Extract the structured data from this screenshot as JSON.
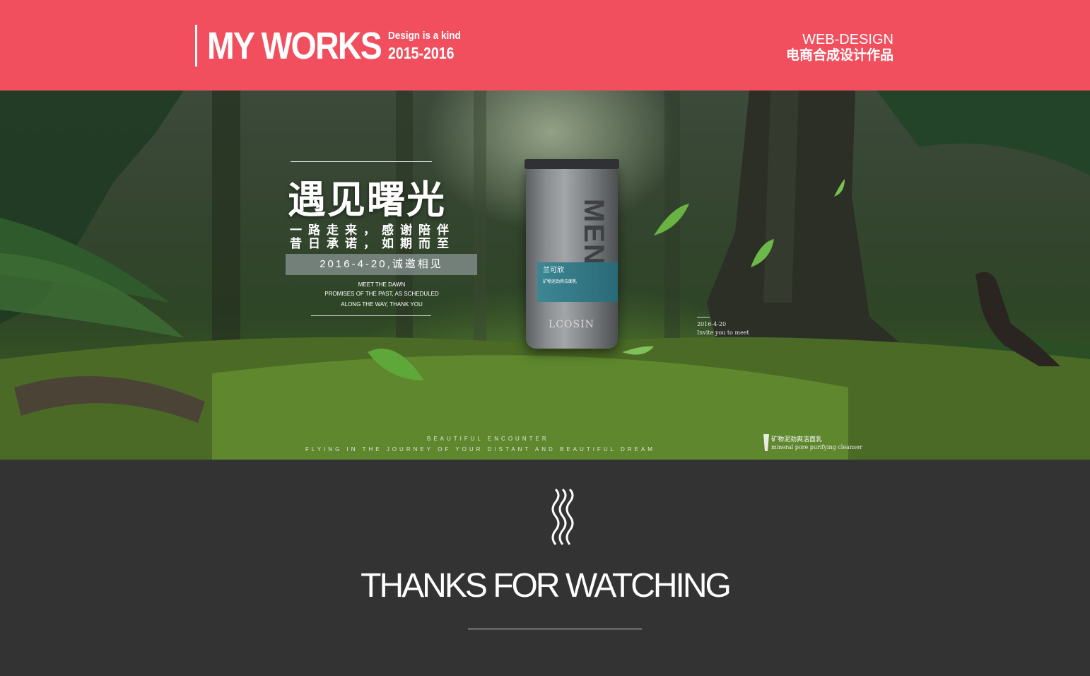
{
  "header": {
    "title": "MY WORKS",
    "tagline": "Design is a kind",
    "years": "2015-2016",
    "category_en": "WEB-DESIGN",
    "category_cn": "电商合成设计作品"
  },
  "banner": {
    "headline_cn": "遇见曙光",
    "line1_cn": "一路走来，感谢陪伴",
    "line2_cn": "昔日承诺，如期而至",
    "date_cn": "2016-4-20,诚邀相见",
    "en_line1": "MEET THE DAWN",
    "en_line2": "PROMISES OF THE PAST, AS SCHEDULED",
    "en_line3": "ALONG THE WAY, THANK YOU",
    "product": {
      "vertical_text": "MEN",
      "brand_cn": "兰可欣",
      "sub_cn": "矿物泥劲爽洁面乳",
      "logo": "LCOSIN"
    },
    "small_date": "2016-4-20",
    "small_invite": "Invite you to meet",
    "bottom_line1": "BEAUTIFUL ENCOUNTER",
    "bottom_line2": "FLYING IN THE JOURNEY OF YOUR DISTANT AND BEAUTIFUL DREAM",
    "cleanser_cn": "矿物泥劲爽洁面乳",
    "cleanser_en": "mineral pore purifying cleanser"
  },
  "footer": {
    "thanks": "THANKS FOR WATCHING"
  },
  "colors": {
    "header_bg": "#f24f5e",
    "footer_bg": "#333333",
    "label_teal": "#3d8794"
  },
  "icons": {
    "footer_wave": "wavy-lines-icon"
  }
}
